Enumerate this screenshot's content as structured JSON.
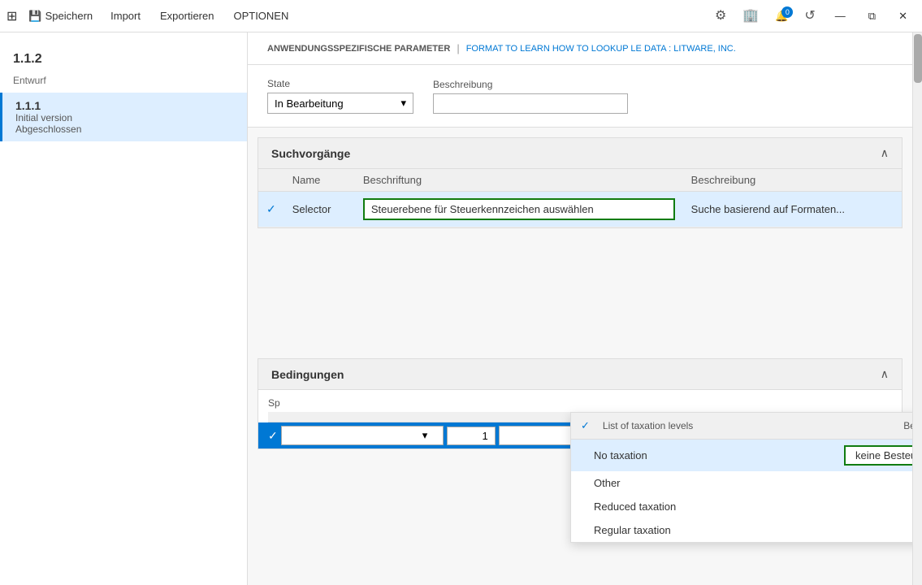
{
  "titlebar": {
    "save_label": "Speichern",
    "import_label": "Import",
    "export_label": "Exportieren",
    "options_label": "OPTIONEN",
    "badge_count": "0",
    "window_controls": [
      "—",
      "⧉",
      "✕"
    ]
  },
  "sidebar": {
    "top_version": "1.1.2",
    "items": [
      {
        "version": "1.1.1",
        "subtitle": "Initial version",
        "status": "Abgeschlossen",
        "active": true,
        "draft_label": "Entwurf"
      }
    ]
  },
  "breadcrumb": {
    "part1": "ANWENDUNGSSPEZIFISCHE PARAMETER",
    "separator": "|",
    "part2": "FORMAT TO LEARN HOW TO LOOKUP LE DATA : LITWARE, INC."
  },
  "form": {
    "state_label": "State",
    "state_value": "In Bearbeitung",
    "beschreibung_label": "Beschreibung",
    "beschreibung_placeholder": ""
  },
  "suchvorgange_section": {
    "title": "Suchvorgänge",
    "columns": [
      "",
      "Name",
      "Beschriftung",
      "Beschreibung"
    ],
    "rows": [
      {
        "checked": true,
        "name": "Selector",
        "beschriftung": "Steuerebene für Steuerkennzeichen auswählen",
        "beschreibung": "Suche basierend auf Formaten...",
        "selected": true
      }
    ]
  },
  "dropdown_panel": {
    "col_name": "List of taxation levels",
    "col_beschriftung": "Beschriftung",
    "items": [
      {
        "name": "No taxation",
        "beschriftung": "keine Besteuerung",
        "selected": true
      },
      {
        "name": "Other",
        "beschriftung": "",
        "selected": false
      },
      {
        "name": "Reduced taxation",
        "beschriftung": "",
        "selected": false
      },
      {
        "name": "Regular taxation",
        "beschriftung": "",
        "selected": false
      }
    ]
  },
  "bedingungen_section": {
    "title": "Bedingungen",
    "sp_label": "Sp",
    "columns": [
      "",
      ""
    ],
    "bottom_row": {
      "checked": true,
      "input_value": "",
      "number_value": "1"
    }
  }
}
